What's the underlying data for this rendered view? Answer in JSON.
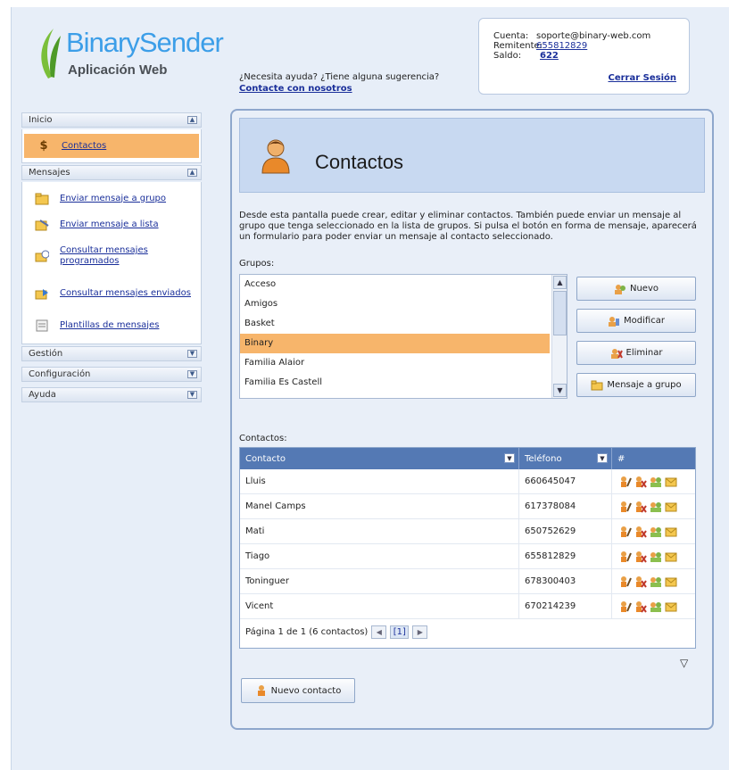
{
  "header": {
    "brand": "BinarySender",
    "subtitle": "Aplicación Web",
    "help_text": "¿Necesita ayuda? ¿Tiene alguna sugerencia?",
    "help_link": "Contacte con nosotros",
    "account": {
      "cuenta_label": "Cuenta:",
      "cuenta_value": "soporte@binary-web.com",
      "remitente_label": "Remitente:",
      "remitente_value": "655812829",
      "saldo_label": "Saldo:",
      "saldo_value": "622",
      "logout": "Cerrar Sesión"
    }
  },
  "sidebar": {
    "inicio": {
      "title": "Inicio",
      "items": [
        {
          "label": "Contactos",
          "icon": "dollar-icon"
        }
      ]
    },
    "mensajes": {
      "title": "Mensajes",
      "items": [
        {
          "label": "Enviar mensaje a grupo",
          "icon": "folder-message-icon"
        },
        {
          "label": "Enviar mensaje a lista",
          "icon": "list-message-icon"
        },
        {
          "label": "Consultar mensajes programados",
          "icon": "scheduled-message-icon"
        },
        {
          "label": "Consultar mensajes enviados",
          "icon": "sent-message-icon"
        },
        {
          "label": "Plantillas de mensajes",
          "icon": "template-icon"
        }
      ]
    },
    "gestion": {
      "title": "Gestión"
    },
    "configuracion": {
      "title": "Configuración"
    },
    "ayuda": {
      "title": "Ayuda"
    }
  },
  "main": {
    "title": "Contactos",
    "description": "Desde esta pantalla puede crear, editar y eliminar contactos. También puede enviar un mensaje al grupo que tenga seleccionado en la lista de grupos. Si pulsa el botón en forma de mensaje, aparecerá un formulario para poder enviar un mensaje al contacto seleccionado.",
    "groups_label": "Grupos:",
    "groups": [
      "Acceso",
      "Amigos",
      "Basket",
      "Binary",
      "Familia Alaior",
      "Familia Es Castell"
    ],
    "selected_group": "Binary",
    "buttons": {
      "nuevo": "Nuevo",
      "modificar": "Modificar",
      "eliminar": "Eliminar",
      "mensaje_grupo": "Mensaje a grupo",
      "nuevo_contacto": "Nuevo contacto"
    },
    "contacts_label": "Contactos:",
    "columns": {
      "contacto": "Contacto",
      "telefono": "Teléfono",
      "actions": "#"
    },
    "rows": [
      {
        "contacto": "Lluis",
        "telefono": "660645047"
      },
      {
        "contacto": "Manel Camps",
        "telefono": "617378084"
      },
      {
        "contacto": "Mati",
        "telefono": "650752629"
      },
      {
        "contacto": "Tiago",
        "telefono": "655812829"
      },
      {
        "contacto": "Toninguer",
        "telefono": "678300403"
      },
      {
        "contacto": "Vicent",
        "telefono": "670214239"
      }
    ],
    "pager": {
      "text": "Página 1 de 1 (6 contactos)",
      "current": "[1]"
    }
  },
  "colors": {
    "accent_orange": "#f7b56b",
    "header_blue": "#5479b4",
    "link": "#1a2f9a",
    "brand": "#3c9ee8"
  }
}
